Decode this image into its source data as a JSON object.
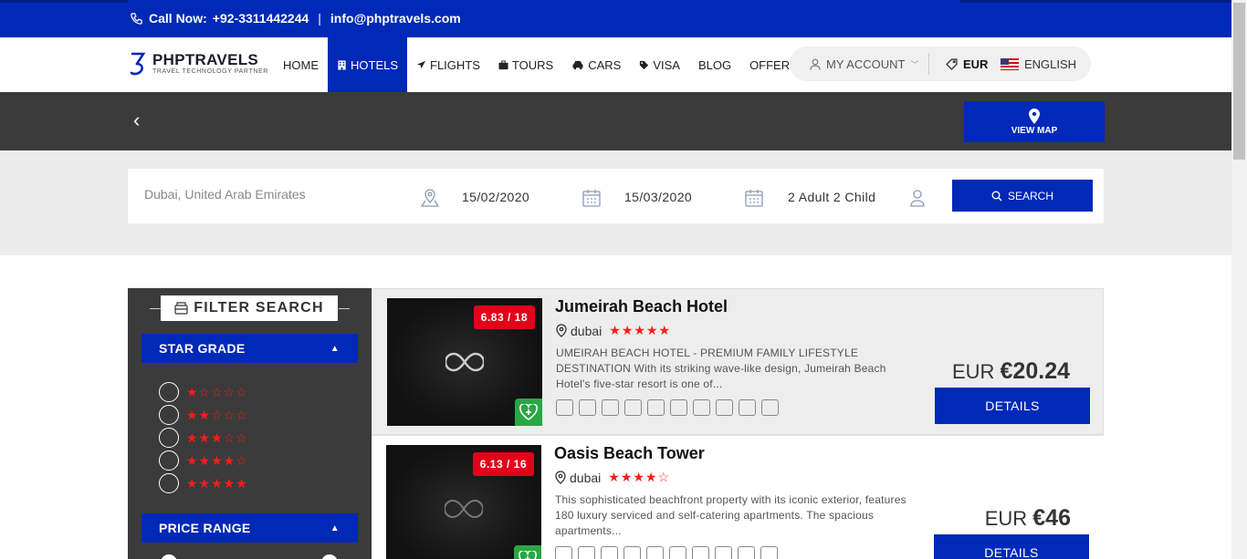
{
  "topbar": {
    "call_label": "Call Now:",
    "phone": "+92-3311442244",
    "separator": "|",
    "email": "info@phptravels.com"
  },
  "brand": {
    "name": "PHPTRAVELS",
    "tagline": "TRAVEL TECHNOLOGY PARTNER",
    "accent": "#0029b8"
  },
  "nav": {
    "items": [
      {
        "label": "HOME",
        "icon": ""
      },
      {
        "label": "HOTELS",
        "icon": "hotel-icon"
      },
      {
        "label": "FLIGHTS",
        "icon": "plane-icon"
      },
      {
        "label": "TOURS",
        "icon": "suitcase-icon"
      },
      {
        "label": "CARS",
        "icon": "car-icon"
      },
      {
        "label": "VISA",
        "icon": "tag-icon"
      },
      {
        "label": "BLOG",
        "icon": ""
      },
      {
        "label": "OFFERS",
        "icon": ""
      }
    ],
    "active": "HOTELS",
    "account_label": "MY ACCOUNT",
    "currency": "EUR",
    "language": "ENGLISH"
  },
  "band": {
    "map_label": "VIEW MAP"
  },
  "search": {
    "location": "Dubai, United Arab Emirates",
    "checkin": "15/02/2020",
    "checkout": "15/03/2020",
    "guests": "2 Adult 2 Child",
    "button_label": "SEARCH"
  },
  "filter": {
    "title": "FILTER SEARCH",
    "star_grade_label": "STAR GRADE",
    "star_rows": [
      "★☆☆☆☆",
      "★★☆☆☆",
      "★★★☆☆",
      "★★★★☆",
      "★★★★★"
    ],
    "price_range_label": "PRICE RANGE"
  },
  "hotels": [
    {
      "name": "Jumeirah Beach Hotel",
      "location": "dubai",
      "stars": "★★★★★",
      "rating": "6.83 / 18",
      "description": "UMEIRAH BEACH HOTEL - PREMIUM FAMILY LIFESTYLE DESTINATION With its striking wave-like design, Jumeirah Beach Hotel's five-star resort is one of...",
      "currency": "EUR",
      "price": "€20.24",
      "details_label": "DETAILS"
    },
    {
      "name": "Oasis Beach Tower",
      "location": "dubai",
      "stars": "★★★★☆",
      "rating": "6.13 / 16",
      "description": "This sophisticated beachfront property with its iconic exterior, features 180 luxury serviced and self-catering apartments. The spacious apartments...",
      "currency": "EUR",
      "price": "€46",
      "details_label": "DETAILS"
    }
  ]
}
